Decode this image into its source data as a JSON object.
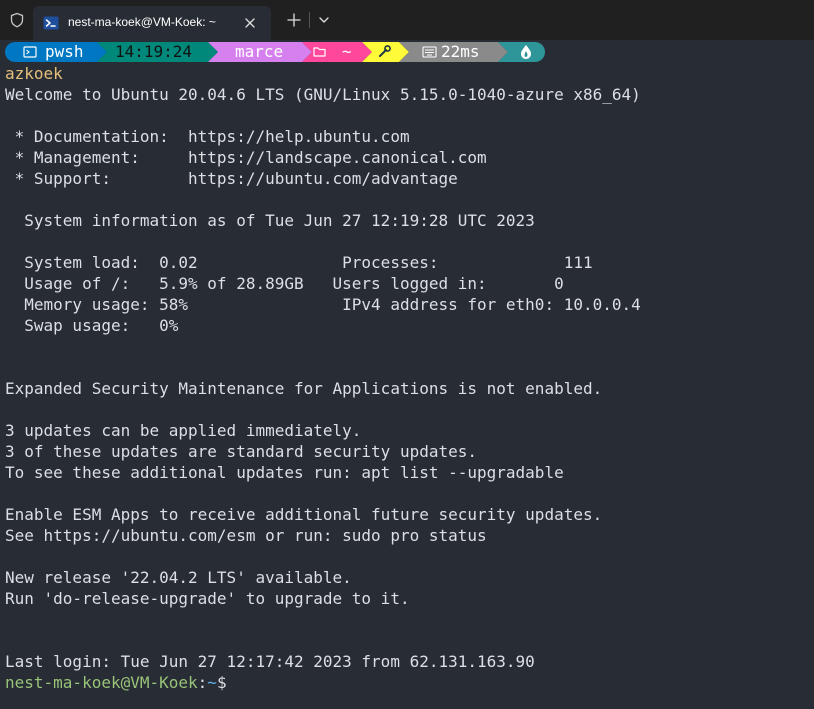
{
  "window": {
    "tab_title": "nest-ma-koek@VM-Koek: ~",
    "new_tab_label": "+",
    "dropdown_label": "⌄"
  },
  "prompt": {
    "shell": "pwsh",
    "time": "14:19:24",
    "user": "marce",
    "path": "~",
    "duration": "22ms",
    "colors": {
      "shell": "#0077c2",
      "time": "#00897b",
      "user": "#d680f0",
      "path": "#ff479c",
      "tools": "#fffb38",
      "duration": "#8a8a8a",
      "status": "#2e9599"
    }
  },
  "terminal": {
    "lines": [
      "azkoek",
      "Welcome to Ubuntu 20.04.6 LTS (GNU/Linux 5.15.0-1040-azure x86_64)",
      "",
      " * Documentation:  https://help.ubuntu.com",
      " * Management:     https://landscape.canonical.com",
      " * Support:        https://ubuntu.com/advantage",
      "",
      "  System information as of Tue Jun 27 12:19:28 UTC 2023",
      "",
      "  System load:  0.02               Processes:             111",
      "  Usage of /:   5.9% of 28.89GB   Users logged in:       0",
      "  Memory usage: 58%                IPv4 address for eth0: 10.0.0.4",
      "  Swap usage:   0%",
      "",
      "",
      "Expanded Security Maintenance for Applications is not enabled.",
      "",
      "3 updates can be applied immediately.",
      "3 of these updates are standard security updates.",
      "To see these additional updates run: apt list --upgradable",
      "",
      "Enable ESM Apps to receive additional future security updates.",
      "See https://ubuntu.com/esm or run: sudo pro status",
      "",
      "New release '22.04.2 LTS' available.",
      "Run 'do-release-upgrade' to upgrade to it.",
      "",
      "",
      "Last login: Tue Jun 27 12:17:42 2023 from 62.131.163.90"
    ],
    "final_prompt": {
      "user_host": "nest-ma-koek@VM-Koek",
      "separator": ":",
      "path": "~",
      "symbol": "$"
    },
    "colors": {
      "background": "#282c34",
      "text": "#dcdfe4",
      "yellow": "#e5c07b",
      "green": "#98c379",
      "blue": "#61afef"
    }
  }
}
